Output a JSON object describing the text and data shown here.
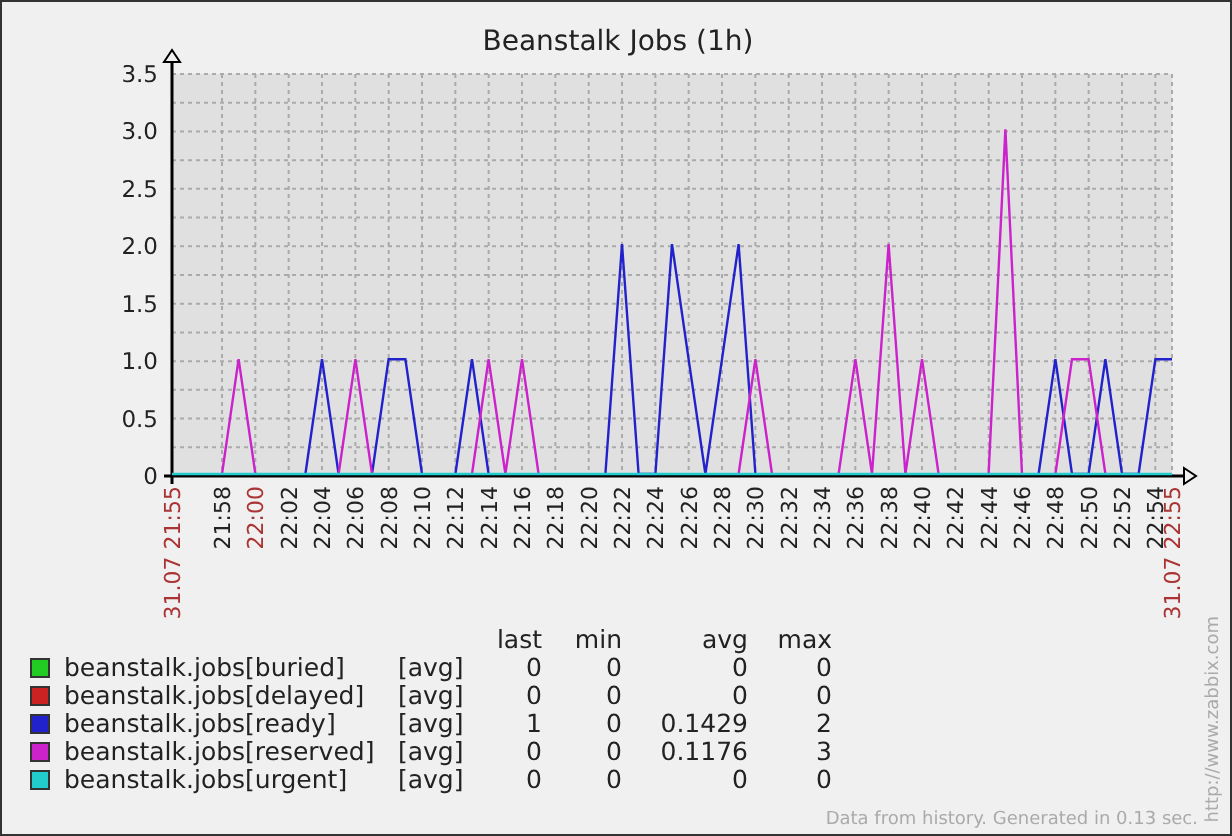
{
  "graph": {
    "chart_data": {
      "type": "line",
      "title": "Beanstalk Jobs (1h)",
      "categories": [
        "31.07 21:55",
        null,
        null,
        "21:58",
        null,
        "22:00",
        null,
        "22:02",
        null,
        "22:04",
        null,
        "22:06",
        null,
        "22:08",
        null,
        "22:10",
        null,
        "22:12",
        null,
        "22:14",
        null,
        "22:16",
        null,
        "22:18",
        null,
        "22:20",
        null,
        "22:22",
        null,
        "22:24",
        null,
        "22:26",
        null,
        "22:28",
        null,
        "22:30",
        null,
        "22:32",
        null,
        "22:34",
        null,
        "22:36",
        null,
        "22:38",
        null,
        "22:40",
        null,
        "22:42",
        null,
        "22:44",
        null,
        "22:46",
        null,
        "22:48",
        null,
        "22:50",
        null,
        "22:52",
        null,
        "22:54",
        "31.07 22:55"
      ],
      "ylim": [
        0,
        3.5
      ],
      "grid": true,
      "yticks": [
        0,
        {
          "value": 0.5,
          "label": "0.5"
        },
        {
          "value": 1,
          "label": "1.0"
        },
        {
          "value": 1.5,
          "label": "1.5"
        },
        {
          "value": 2,
          "label": "2.0"
        },
        {
          "value": 2.5,
          "label": "2.5"
        },
        {
          "value": 3,
          "label": "3.0"
        },
        {
          "value": 3.5,
          "label": "3.5"
        }
      ],
      "series": [
        {
          "name": "beanstalk.jobs[buried]",
          "color": "#22cc22",
          "values": [
            null,
            null,
            null,
            null,
            null,
            null,
            null,
            null,
            null,
            null,
            null,
            null,
            null,
            null,
            null,
            null,
            null,
            null,
            null,
            null,
            null,
            null,
            null,
            null,
            null,
            null,
            null,
            null,
            null,
            null,
            null,
            null,
            null,
            null,
            null,
            null,
            null,
            null,
            null,
            null,
            null,
            null,
            null,
            null,
            null,
            null,
            null,
            null,
            null,
            null,
            null,
            null,
            null,
            null,
            null,
            null,
            null,
            null,
            null,
            null,
            null
          ]
        },
        {
          "name": "beanstalk.jobs[delayed]",
          "color": "#cc2222",
          "values": [
            null,
            null,
            null,
            null,
            null,
            null,
            null,
            null,
            null,
            null,
            null,
            null,
            null,
            null,
            null,
            null,
            null,
            null,
            null,
            null,
            null,
            null,
            null,
            null,
            null,
            null,
            null,
            null,
            null,
            null,
            null,
            null,
            null,
            null,
            null,
            null,
            null,
            null,
            null,
            null,
            null,
            null,
            null,
            null,
            null,
            null,
            null,
            null,
            null,
            null,
            null,
            null,
            null,
            null,
            null,
            null,
            null,
            null,
            null,
            null,
            null
          ]
        },
        {
          "name": "beanstalk.jobs[ready]",
          "color": "#2222cc",
          "values": [
            null,
            null,
            null,
            null,
            null,
            null,
            null,
            null,
            0,
            1,
            0,
            null,
            0,
            1,
            1,
            0,
            null,
            0,
            1,
            0,
            null,
            null,
            null,
            null,
            null,
            null,
            0,
            2,
            0,
            0,
            2,
            1,
            0,
            1,
            2,
            0,
            null,
            null,
            null,
            null,
            null,
            null,
            null,
            null,
            null,
            null,
            null,
            null,
            null,
            null,
            null,
            null,
            0,
            1,
            0,
            0,
            1,
            0,
            0,
            1,
            1
          ]
        },
        {
          "name": "beanstalk.jobs[reserved]",
          "color": "#cc22cc",
          "values": [
            null,
            null,
            null,
            0,
            1,
            0,
            null,
            null,
            null,
            null,
            0,
            1,
            0,
            null,
            null,
            null,
            null,
            null,
            0,
            1,
            0,
            1,
            0,
            null,
            null,
            null,
            null,
            null,
            null,
            null,
            null,
            null,
            null,
            null,
            0,
            1,
            0,
            null,
            null,
            null,
            0,
            1,
            0,
            2,
            0,
            1,
            0,
            null,
            null,
            0,
            3,
            0,
            null,
            0,
            1,
            1,
            0,
            null,
            null,
            null,
            null
          ]
        },
        {
          "name": "beanstalk.jobs[urgent]",
          "color": "#22cccc",
          "values": [
            0,
            0,
            0,
            0,
            0,
            0,
            0,
            0,
            0,
            0,
            0,
            0,
            0,
            0,
            0,
            0,
            0,
            0,
            0,
            0,
            0,
            0,
            0,
            0,
            0,
            0,
            0,
            0,
            0,
            0,
            0,
            0,
            0,
            0,
            0,
            0,
            0,
            0,
            0,
            0,
            0,
            0,
            0,
            0,
            0,
            0,
            0,
            0,
            0,
            0,
            0,
            0,
            0,
            0,
            0,
            0,
            0,
            0,
            0,
            0,
            0
          ]
        }
      ]
    },
    "axis_labels": [
      {
        "highlighted": true
      },
      {
        "highlighted": false
      },
      {
        "highlighted": true
      },
      {
        "highlighted": false
      },
      {
        "highlighted": false
      },
      {
        "highlighted": false
      },
      {
        "highlighted": false
      },
      {
        "highlighted": false
      },
      {
        "highlighted": false
      },
      {
        "highlighted": false
      },
      {
        "highlighted": false
      },
      {
        "highlighted": false
      },
      {
        "highlighted": false
      },
      {
        "highlighted": false
      },
      {
        "highlighted": false
      },
      {
        "highlighted": false
      },
      {
        "highlighted": false
      },
      {
        "highlighted": false
      },
      {
        "highlighted": false
      },
      {
        "highlighted": false
      },
      {
        "highlighted": false
      },
      {
        "highlighted": false
      },
      {
        "highlighted": false
      },
      {
        "highlighted": false
      },
      {
        "highlighted": false
      },
      {
        "highlighted": false
      },
      {
        "highlighted": false
      },
      {
        "highlighted": false
      },
      {
        "highlighted": false
      },
      {
        "highlighted": false
      },
      {
        "highlighted": true
      }
    ]
  },
  "legend": {
    "columns": [
      "last",
      "min",
      "avg",
      "max"
    ],
    "items": [
      {
        "function": "[avg]",
        "last": "0",
        "min": "0",
        "avg": "0",
        "max": "0"
      },
      {
        "function": "[avg]",
        "last": "0",
        "min": "0",
        "avg": "0",
        "max": "0"
      },
      {
        "function": "[avg]",
        "last": "1",
        "min": "0",
        "avg": "0.1429",
        "max": "2"
      },
      {
        "function": "[avg]",
        "last": "0",
        "min": "0",
        "avg": "0.1176",
        "max": "3"
      },
      {
        "function": "[avg]",
        "last": "0",
        "min": "0",
        "avg": "0",
        "max": "0"
      }
    ]
  },
  "footer": "Data from history. Generated in 0.13 sec.",
  "link": "http://www.zabbix.com"
}
